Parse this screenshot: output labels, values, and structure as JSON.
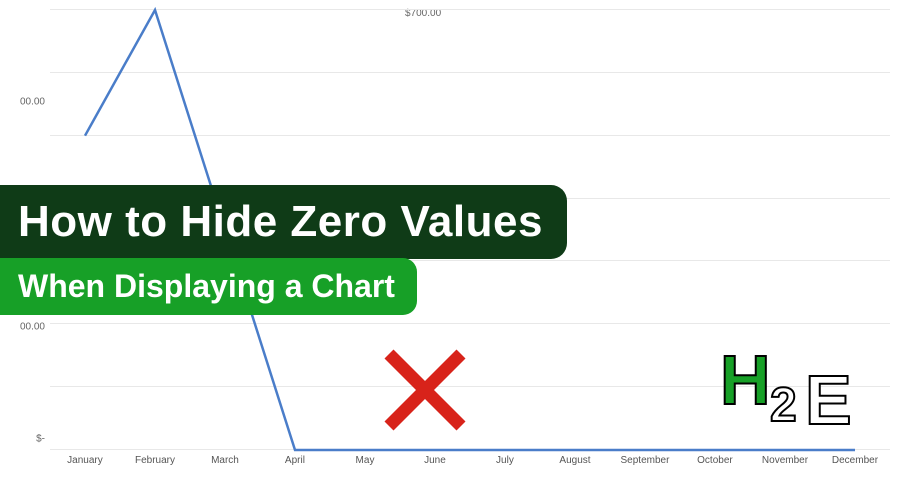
{
  "chart_data": {
    "type": "line",
    "categories": [
      "January",
      "February",
      "March",
      "April",
      "May",
      "June",
      "July",
      "August",
      "September",
      "October",
      "November",
      "December"
    ],
    "values": [
      500,
      700,
      350,
      0,
      0,
      0,
      0,
      0,
      0,
      0,
      0,
      0
    ],
    "ylabel": "",
    "xlabel": "",
    "ylim": [
      0,
      700
    ],
    "y_ticks": [
      "$-",
      "00.00",
      "00.00",
      "00.00",
      "$700.00"
    ],
    "line_color": "#4a7dc9"
  },
  "overlay": {
    "title_line1": "How to Hide Zero Values",
    "title_line2": "When Displaying a Chart"
  },
  "logo": {
    "part1": "H",
    "part2": "2",
    "part3": "E"
  },
  "colors": {
    "banner1": "#0f3b17",
    "banner2": "#17a027",
    "xmark": "#d8231a",
    "line": "#4a7dc9",
    "logo_accent": "#17a027"
  }
}
